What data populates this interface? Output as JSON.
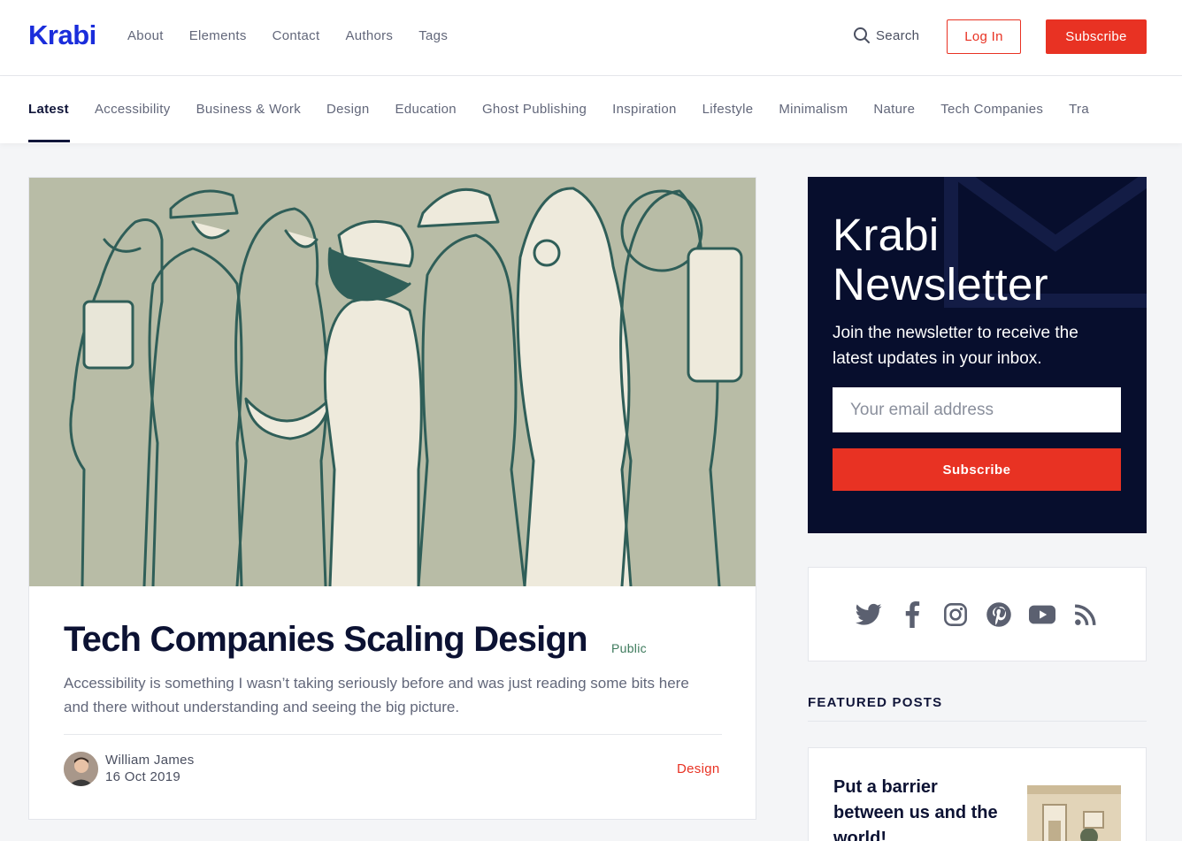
{
  "header": {
    "logo": "Krabi",
    "nav": [
      "About",
      "Elements",
      "Contact",
      "Authors",
      "Tags"
    ],
    "search_label": "Search",
    "login_label": "Log In",
    "subscribe_label": "Subscribe"
  },
  "tags": [
    "Latest",
    "Accessibility",
    "Business & Work",
    "Design",
    "Education",
    "Ghost Publishing",
    "Inspiration",
    "Lifestyle",
    "Minimalism",
    "Nature",
    "Tech Companies",
    "Tra"
  ],
  "post": {
    "title": "Tech Companies Scaling Design",
    "badge": "Public",
    "excerpt": "Accessibility is something I wasn’t taking seriously before and was just reading some bits here and there without understanding and seeing the big picture.",
    "author": "William James",
    "date": "16 Oct 2019",
    "tag": "Design"
  },
  "newsletter": {
    "title": "Krabi Newsletter",
    "description": "Join the newsletter to receive the latest updates in your inbox.",
    "email_placeholder": "Your email address",
    "button_label": "Subscribe"
  },
  "social_icons": [
    "twitter-icon",
    "facebook-icon",
    "instagram-icon",
    "pinterest-icon",
    "youtube-icon",
    "rss-icon"
  ],
  "featured": {
    "heading": "FEATURED POSTS",
    "first_title": "Put a barrier between us and the world!"
  },
  "colors": {
    "brand": "#1a2ddb",
    "accent": "#e83223",
    "newsletter_bg": "#070e2d",
    "hero_bg": "#b8bca6",
    "badge_green": "#3d7a5c"
  }
}
